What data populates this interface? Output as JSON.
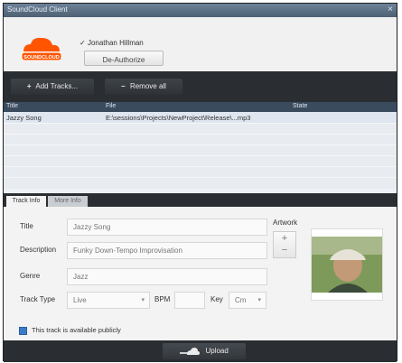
{
  "window": {
    "title": "SoundCloud Client",
    "close_glyph": "×"
  },
  "header": {
    "logo_text": "SOUNDCLOUD",
    "logo_icon": "soundcloud-cloud-icon",
    "user_label": "Jonathan Hillman",
    "user_check": "✓",
    "deauthorize_label": "De-Authorize"
  },
  "toolbar": {
    "add_icon": "+",
    "add_label": "Add Tracks...",
    "remove_icon": "−",
    "remove_label": "Remove all"
  },
  "tracks": {
    "columns": [
      "Title",
      "File",
      "State"
    ],
    "rows": [
      {
        "title": "Jazzy Song",
        "file": "E:\\sessions\\Projects\\NewProject\\Release\\...mp3",
        "state": ""
      }
    ]
  },
  "tabs": [
    {
      "label": "Track Info",
      "active": true
    },
    {
      "label": "More Info",
      "active": false
    }
  ],
  "track_info": {
    "title_label": "Title",
    "title_value": "Jazzy Song",
    "description_label": "Description",
    "description_value": "Funky Down-Tempo Improvisation",
    "genre_label": "Genre",
    "genre_value": "Jazz",
    "track_type_label": "Track Type",
    "track_type_value": "Live",
    "bpm_label": "BPM",
    "bpm_value": "",
    "key_label": "Key",
    "key_value": "Cm",
    "artwork_label": "Artwork",
    "artwork_add": "+",
    "artwork_remove": "−",
    "public_label": "This track is available publicly",
    "public_checked": true
  },
  "footer": {
    "upload_label": "Upload",
    "upload_icon": "upload-cloud-icon"
  },
  "colors": {
    "brand_orange": "#ff5500",
    "toolbar_dark": "#2a2e32",
    "grid_header": "#3a4b5d",
    "checkbox_blue": "#3a7bc8"
  }
}
